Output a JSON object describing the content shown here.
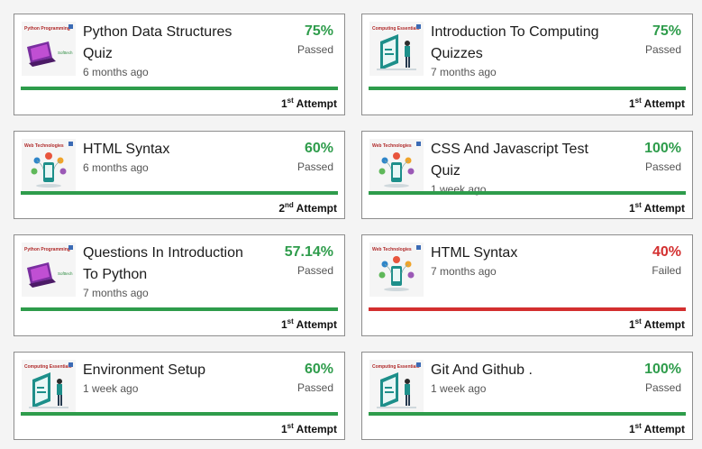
{
  "colors": {
    "passed": "#2e9c4b",
    "failed": "#d32f2f"
  },
  "cards": [
    {
      "title": "Python Data Structures Quiz",
      "time": "6 months ago",
      "percent": "75%",
      "status": "Passed",
      "attempt_num": "1",
      "attempt_sup": "st",
      "attempt_label": "Attempt",
      "thumb": "python-programming-thumbnail",
      "thumb_label": "Python Programming",
      "thumb_label2": "Softtech"
    },
    {
      "title": "Introduction To Computing Quizzes",
      "time": "7 months ago",
      "percent": "75%",
      "status": "Passed",
      "attempt_num": "1",
      "attempt_sup": "st",
      "attempt_label": "Attempt",
      "thumb": "computing-essentials-thumbnail",
      "thumb_label": "Computing Essentials"
    },
    {
      "title": "HTML Syntax",
      "time": "6 months ago",
      "percent": "60%",
      "status": "Passed",
      "attempt_num": "2",
      "attempt_sup": "nd",
      "attempt_label": "Attempt",
      "thumb": "web-technologies-thumbnail",
      "thumb_label": "Web Technologies"
    },
    {
      "title": "CSS And Javascript Test Quiz",
      "time": "1 week ago",
      "percent": "100%",
      "status": "Passed",
      "attempt_num": "1",
      "attempt_sup": "st",
      "attempt_label": "Attempt",
      "thumb": "web-technologies-thumbnail",
      "thumb_label": "Web Technologies"
    },
    {
      "title": "Questions In Introduction To Python",
      "time": "7 months ago",
      "percent": "57.14%",
      "status": "Passed",
      "attempt_num": "1",
      "attempt_sup": "st",
      "attempt_label": "Attempt",
      "thumb": "python-programming-thumbnail",
      "thumb_label": "Python Programming",
      "thumb_label2": "Softtech"
    },
    {
      "title": "HTML Syntax",
      "time": "7 months ago",
      "percent": "40%",
      "status": "Failed",
      "attempt_num": "1",
      "attempt_sup": "st",
      "attempt_label": "Attempt",
      "thumb": "web-technologies-thumbnail",
      "thumb_label": "Web Technologies"
    },
    {
      "title": "Environment Setup",
      "time": "1 week ago",
      "percent": "60%",
      "status": "Passed",
      "attempt_num": "1",
      "attempt_sup": "st",
      "attempt_label": "Attempt",
      "thumb": "computing-essentials-thumbnail",
      "thumb_label": "Computing Essentials"
    },
    {
      "title": "Git And Github .",
      "time": "1 week ago",
      "percent": "100%",
      "status": "Passed",
      "attempt_num": "1",
      "attempt_sup": "st",
      "attempt_label": "Attempt",
      "thumb": "computing-essentials-thumbnail",
      "thumb_label": "Computing Essentials"
    }
  ]
}
